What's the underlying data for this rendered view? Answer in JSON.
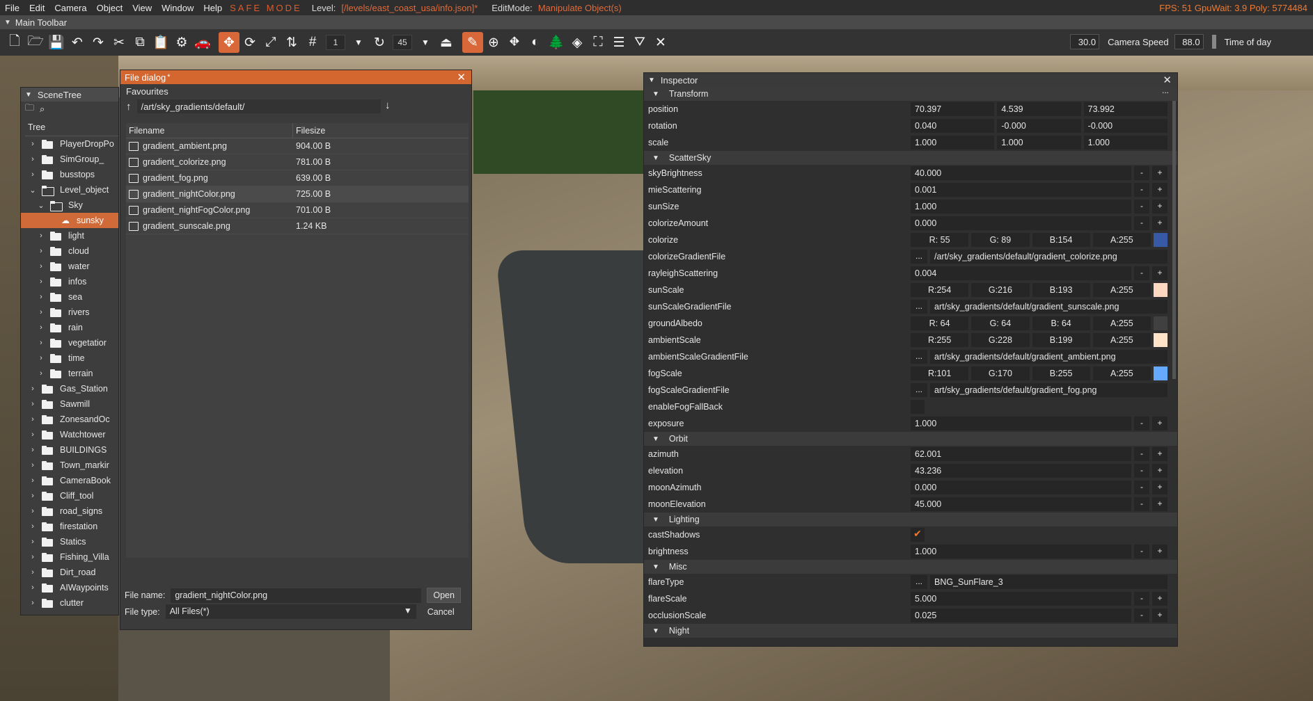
{
  "menubar": {
    "items": [
      "File",
      "Edit",
      "Camera",
      "Object",
      "View",
      "Window",
      "Help"
    ],
    "safe_mode": "SAFE MODE",
    "level_label": "Level:",
    "level_path": "[/levels/east_coast_usa/info.json]*",
    "editmode_label": "EditMode:",
    "editmode_value": "Manipulate Object(s)",
    "stats": "FPS: 51  GpuWait: 3.9  Poly: 5774484"
  },
  "toolbar": {
    "title": "Main Toolbar",
    "grid_value": "1",
    "angle_value": "45",
    "camera_speed_value": "30.0",
    "camera_speed_label": "Camera Speed",
    "time_value": "88.0",
    "time_label": "Time of day"
  },
  "scenetree": {
    "title": "SceneTree",
    "header": "Tree",
    "items": [
      {
        "label": "PlayerDropPo",
        "depth": 0,
        "kind": "folder",
        "expanded": false
      },
      {
        "label": "SimGroup_",
        "depth": 0,
        "kind": "folder",
        "expanded": false
      },
      {
        "label": "busstops",
        "depth": 0,
        "kind": "folder",
        "expanded": false
      },
      {
        "label": "Level_object",
        "depth": 0,
        "kind": "folder",
        "expanded": true
      },
      {
        "label": "Sky",
        "depth": 1,
        "kind": "folder",
        "expanded": true
      },
      {
        "label": "sunsky",
        "depth": 2,
        "kind": "object",
        "selected": true
      },
      {
        "label": "light",
        "depth": 1,
        "kind": "folder",
        "expanded": false
      },
      {
        "label": "cloud",
        "depth": 1,
        "kind": "folder",
        "expanded": false
      },
      {
        "label": "water",
        "depth": 1,
        "kind": "folder",
        "expanded": false
      },
      {
        "label": "infos",
        "depth": 1,
        "kind": "folder",
        "expanded": false
      },
      {
        "label": "sea",
        "depth": 1,
        "kind": "folder",
        "expanded": false
      },
      {
        "label": "rivers",
        "depth": 1,
        "kind": "folder",
        "expanded": false
      },
      {
        "label": "rain",
        "depth": 1,
        "kind": "folder",
        "expanded": false
      },
      {
        "label": "vegetatior",
        "depth": 1,
        "kind": "folder",
        "expanded": false
      },
      {
        "label": "time",
        "depth": 1,
        "kind": "folder",
        "expanded": false
      },
      {
        "label": "terrain",
        "depth": 1,
        "kind": "folder",
        "expanded": false
      },
      {
        "label": "Gas_Station",
        "depth": 0,
        "kind": "folder",
        "expanded": false
      },
      {
        "label": "Sawmill",
        "depth": 0,
        "kind": "folder",
        "expanded": false
      },
      {
        "label": "ZonesandOc",
        "depth": 0,
        "kind": "folder",
        "expanded": false
      },
      {
        "label": "Watchtower",
        "depth": 0,
        "kind": "folder",
        "expanded": false
      },
      {
        "label": "BUILDINGS",
        "depth": 0,
        "kind": "folder",
        "expanded": false
      },
      {
        "label": "Town_markir",
        "depth": 0,
        "kind": "folder",
        "expanded": false
      },
      {
        "label": "CameraBook",
        "depth": 0,
        "kind": "folder",
        "expanded": false
      },
      {
        "label": "Cliff_tool",
        "depth": 0,
        "kind": "folder",
        "expanded": false
      },
      {
        "label": "road_signs",
        "depth": 0,
        "kind": "folder",
        "expanded": false
      },
      {
        "label": "firestation",
        "depth": 0,
        "kind": "folder",
        "expanded": false
      },
      {
        "label": "Statics",
        "depth": 0,
        "kind": "folder",
        "expanded": false
      },
      {
        "label": "Fishing_Villa",
        "depth": 0,
        "kind": "folder",
        "expanded": false
      },
      {
        "label": "Dirt_road",
        "depth": 0,
        "kind": "folder",
        "expanded": false
      },
      {
        "label": "AIWaypoints",
        "depth": 0,
        "kind": "folder",
        "expanded": false
      },
      {
        "label": "clutter",
        "depth": 0,
        "kind": "folder",
        "expanded": false
      }
    ]
  },
  "filedialog": {
    "title": "File dialog",
    "title_mark": "*",
    "favourites_label": "Favourites",
    "path": "/art/sky_gradients/default/",
    "col_filename": "Filename",
    "col_filesize": "Filesize",
    "files": [
      {
        "name": "gradient_ambient.png",
        "size": "904.00 B"
      },
      {
        "name": "gradient_colorize.png",
        "size": "781.00 B"
      },
      {
        "name": "gradient_fog.png",
        "size": "639.00 B"
      },
      {
        "name": "gradient_nightColor.png",
        "size": "725.00 B",
        "selected": true
      },
      {
        "name": "gradient_nightFogColor.png",
        "size": "701.00 B"
      },
      {
        "name": "gradient_sunscale.png",
        "size": "1.24 KB"
      }
    ],
    "filename_label": "File name:",
    "filename_value": "gradient_nightColor.png",
    "open_label": "Open",
    "filetype_label": "File type:",
    "filetype_value": "All Files(*)",
    "cancel_label": "Cancel"
  },
  "inspector": {
    "title": "Inspector",
    "sections": [
      {
        "title": "Transform",
        "props": [
          {
            "name": "position",
            "type": "vec3",
            "values": [
              "70.397",
              "4.539",
              "73.992"
            ]
          },
          {
            "name": "rotation",
            "type": "vec3",
            "values": [
              "0.040",
              "-0.000",
              "-0.000"
            ]
          },
          {
            "name": "scale",
            "type": "vec3",
            "values": [
              "1.000",
              "1.000",
              "1.000"
            ]
          }
        ]
      },
      {
        "title": "ScatterSky",
        "props": [
          {
            "name": "skyBrightness",
            "type": "num",
            "value": "40.000"
          },
          {
            "name": "mieScattering",
            "type": "num",
            "value": "0.001"
          },
          {
            "name": "sunSize",
            "type": "num",
            "value": "1.000"
          },
          {
            "name": "colorizeAmount",
            "type": "num",
            "value": "0.000"
          },
          {
            "name": "colorize",
            "type": "color",
            "values": [
              "R: 55",
              "G: 89",
              "B:154",
              "A:255"
            ],
            "swatch": "#3759a6"
          },
          {
            "name": "colorizeGradientFile",
            "type": "file",
            "dots": "...",
            "value": "/art/sky_gradients/default/gradient_colorize.png"
          },
          {
            "name": "rayleighScattering",
            "type": "num",
            "value": "0.004"
          },
          {
            "name": "sunScale",
            "type": "color",
            "values": [
              "R:254",
              "G:216",
              "B:193",
              "A:255"
            ],
            "swatch": "#fed8c1"
          },
          {
            "name": "sunScaleGradientFile",
            "type": "file",
            "dots": "...",
            "value": "art/sky_gradients/default/gradient_sunscale.png"
          },
          {
            "name": "groundAlbedo",
            "type": "color",
            "values": [
              "R: 64",
              "G: 64",
              "B: 64",
              "A:255"
            ],
            "swatch": "#404040"
          },
          {
            "name": "ambientScale",
            "type": "color",
            "values": [
              "R:255",
              "G:228",
              "B:199",
              "A:255"
            ],
            "swatch": "#ffe4c7"
          },
          {
            "name": "ambientScaleGradientFile",
            "type": "file",
            "dots": "...",
            "value": "art/sky_gradients/default/gradient_ambient.png"
          },
          {
            "name": "fogScale",
            "type": "color",
            "values": [
              "R:101",
              "G:170",
              "B:255",
              "A:255"
            ],
            "swatch": "#65aaff"
          },
          {
            "name": "fogScaleGradientFile",
            "type": "file",
            "dots": "...",
            "value": "art/sky_gradients/default/gradient_fog.png"
          },
          {
            "name": "enableFogFallBack",
            "type": "bool",
            "checked": false
          },
          {
            "name": "exposure",
            "type": "num",
            "value": "1.000"
          }
        ]
      },
      {
        "title": "Orbit",
        "props": [
          {
            "name": "azimuth",
            "type": "num",
            "value": "62.001"
          },
          {
            "name": "elevation",
            "type": "num",
            "value": "43.236"
          },
          {
            "name": "moonAzimuth",
            "type": "num",
            "value": "0.000"
          },
          {
            "name": "moonElevation",
            "type": "num",
            "value": "45.000"
          }
        ]
      },
      {
        "title": "Lighting",
        "props": [
          {
            "name": "castShadows",
            "type": "bool",
            "checked": true
          },
          {
            "name": "brightness",
            "type": "num",
            "value": "1.000"
          }
        ]
      },
      {
        "title": "Misc",
        "props": [
          {
            "name": "flareType",
            "type": "file",
            "dots": "...",
            "value": "BNG_SunFlare_3"
          },
          {
            "name": "flareScale",
            "type": "num",
            "value": "5.000"
          },
          {
            "name": "occlusionScale",
            "type": "num",
            "value": "0.025"
          }
        ]
      },
      {
        "title": "Night",
        "props": []
      }
    ],
    "minus": "-",
    "plus": "+",
    "check_glyph": "✔",
    "title_dots": "..."
  },
  "colors": {
    "accent": "#d4662f",
    "safe_mode": "#e05a2a",
    "stats": "#f07a30"
  }
}
